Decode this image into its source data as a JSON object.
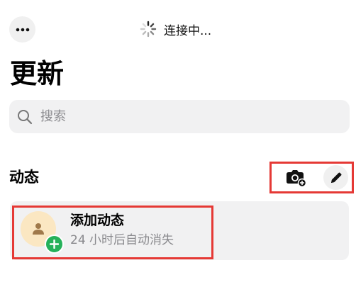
{
  "topbar": {
    "more_icon": "ellipsis-icon",
    "connection_spinner_icon": "spinner-icon",
    "connection_text": "连接中..."
  },
  "page": {
    "title": "更新"
  },
  "search": {
    "icon": "search-icon",
    "placeholder": "搜索"
  },
  "status_section": {
    "title": "动态",
    "camera_icon": "camera-add-icon",
    "pencil_icon": "pencil-icon",
    "add_status": {
      "avatar_icon": "person-icon",
      "badge_icon": "plus-icon",
      "title": "添加动态",
      "subtitle": "24 小时后自动消失"
    }
  },
  "colors": {
    "highlight": "#e53935",
    "badge_green": "#25b15a",
    "avatar_bg": "#fbe7c2",
    "avatar_fg": "#a0794a",
    "surface": "#f1f1f2"
  }
}
